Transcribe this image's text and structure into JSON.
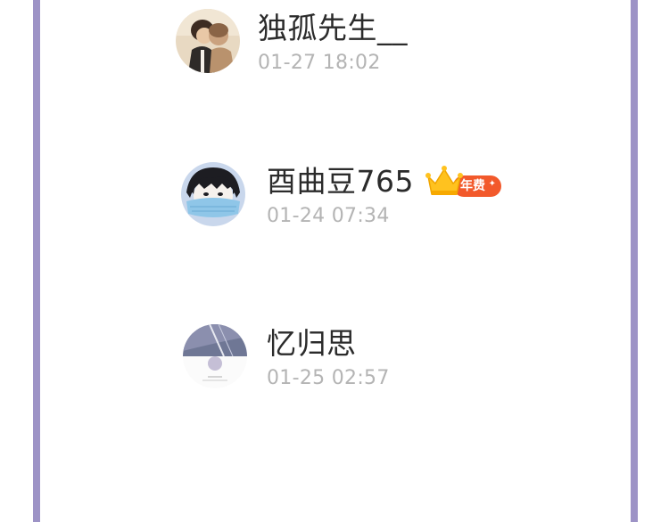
{
  "entries": [
    {
      "name": "独孤先生__",
      "time": "01-27 18:02",
      "avatar": "illustrated-couple-avatar",
      "badge": null
    },
    {
      "name": "酉曲豆765",
      "time": "01-24 07:34",
      "avatar": "masked-boy-avatar",
      "badge": {
        "label": "年费",
        "icon": "crown-icon",
        "color": "#f2592b"
      }
    },
    {
      "name": "忆归思",
      "time": "01-25 02:57",
      "avatar": "sky-cat-avatar",
      "badge": null
    }
  ],
  "colors": {
    "border": "#9d93c6",
    "name": "#2b2b2b",
    "time": "#b4b4b4"
  }
}
